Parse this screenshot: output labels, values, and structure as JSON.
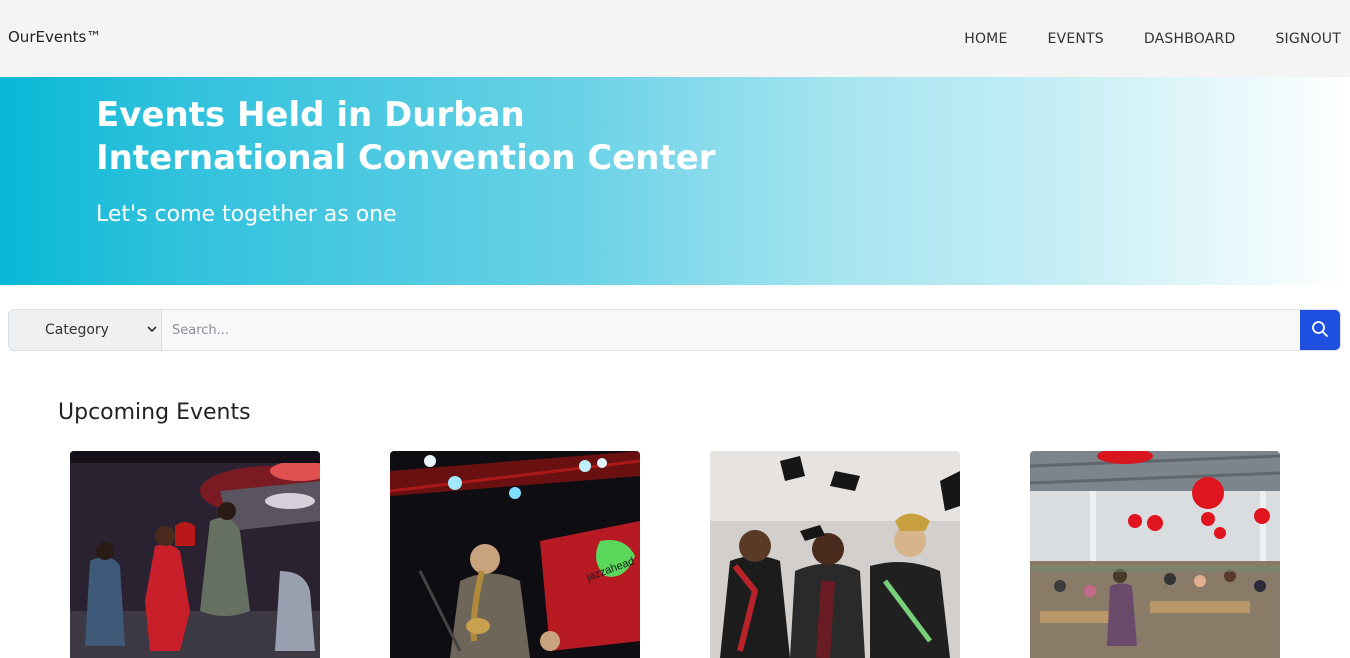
{
  "navbar": {
    "brand": "OurEvents™",
    "links": [
      "HOME",
      "EVENTS",
      "DASHBOARD",
      "SIGNOUT"
    ]
  },
  "hero": {
    "title_line1": "Events Held in Durban",
    "title_line2": "International Convention Center",
    "subtitle": "Let's come together as one"
  },
  "search": {
    "category_label": "Category",
    "placeholder": "Search..."
  },
  "upcoming": {
    "title": "Upcoming Events",
    "cards": [
      {
        "image": "concert-performers-photo"
      },
      {
        "image": "jazz-saxophonist-photo",
        "banner_text": "jazzahead"
      },
      {
        "image": "graduation-ceremony-photo"
      },
      {
        "image": "indoor-market-hall-photo"
      }
    ]
  },
  "colors": {
    "primary_button": "#1f4fe0",
    "hero_start": "#07b8d6",
    "navbar_bg": "#f3f4f3"
  }
}
